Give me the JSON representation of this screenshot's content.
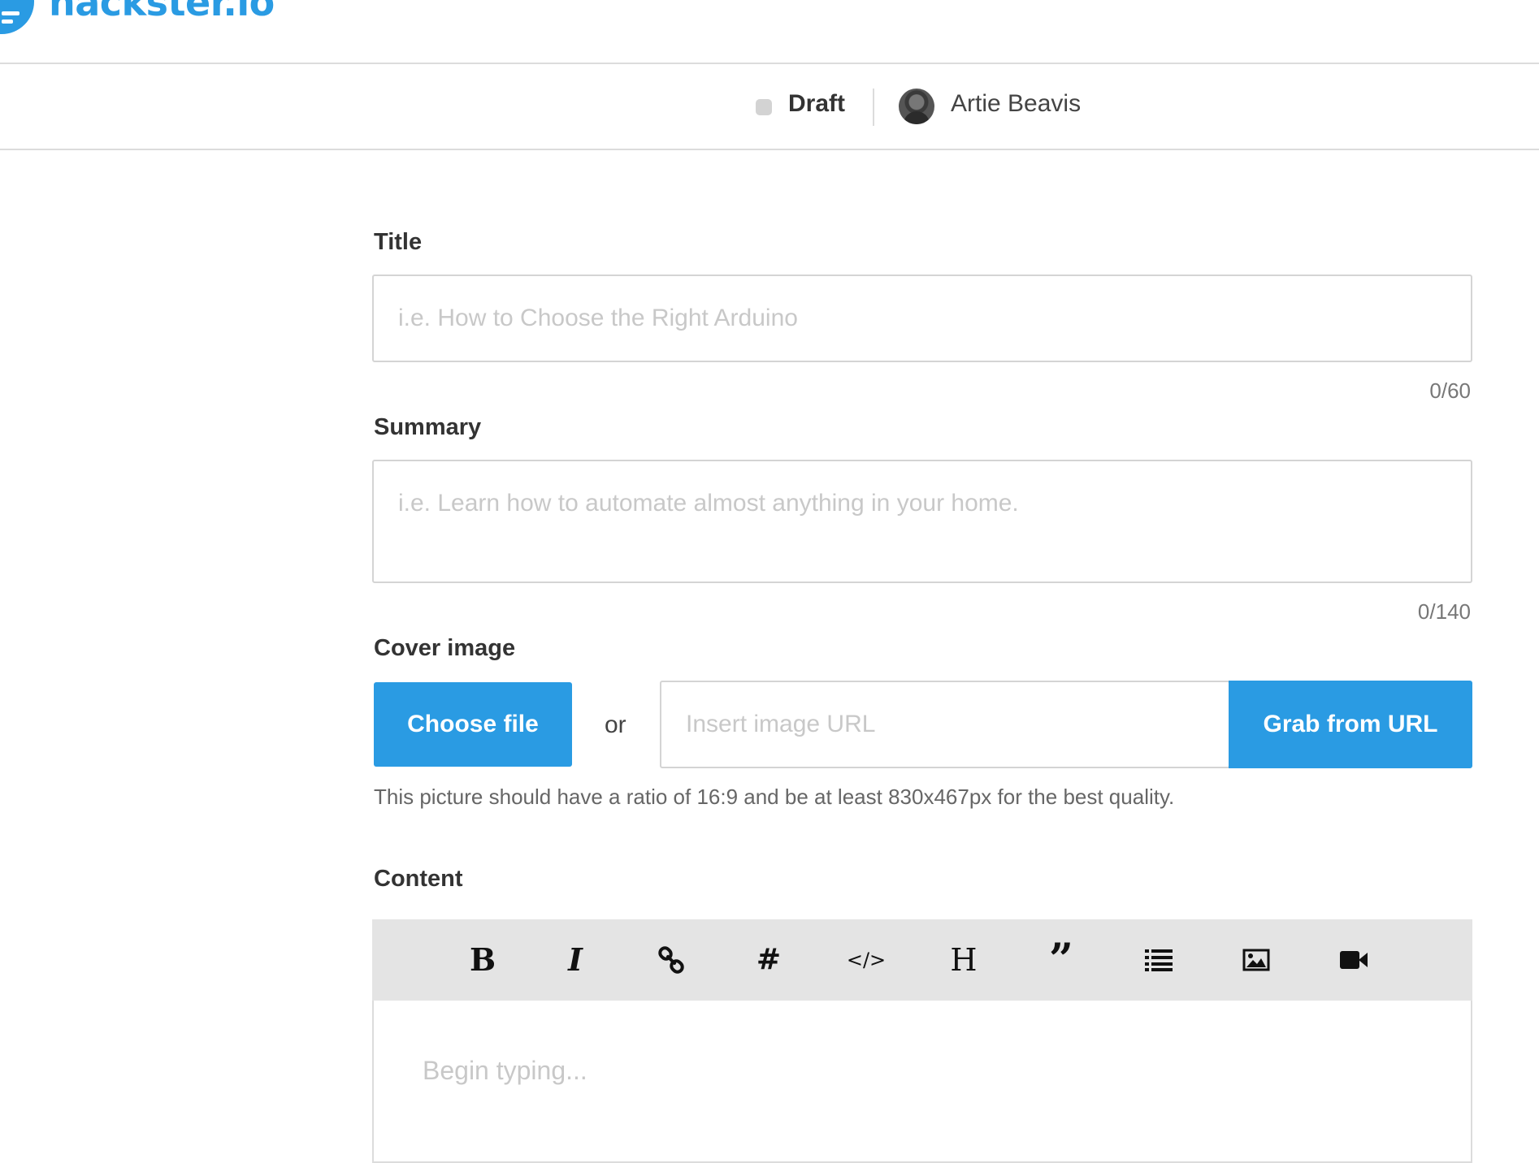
{
  "header": {
    "logo_text": "hackster.io"
  },
  "subheader": {
    "status": "Draft",
    "user_name": "Artie Beavis"
  },
  "form": {
    "title": {
      "label": "Title",
      "placeholder": "i.e. How to Choose the Right Arduino",
      "value": "",
      "counter": "0/60"
    },
    "summary": {
      "label": "Summary",
      "placeholder": "i.e. Learn how to automate almost anything in your home.",
      "value": "",
      "counter": "0/140"
    },
    "cover": {
      "label": "Cover image",
      "choose_file_label": "Choose file",
      "or_text": "or",
      "url_placeholder": "Insert image URL",
      "url_value": "",
      "grab_label": "Grab from URL",
      "hint": "This picture should have a ratio of 16:9 and be at least 830x467px for the best quality."
    },
    "content": {
      "label": "Content",
      "placeholder": "Begin typing...",
      "toolbar": [
        {
          "name": "bold",
          "icon": "bold-icon"
        },
        {
          "name": "italic",
          "icon": "italic-icon"
        },
        {
          "name": "link",
          "icon": "link-icon"
        },
        {
          "name": "hashtag",
          "icon": "hashtag-icon"
        },
        {
          "name": "code",
          "icon": "code-icon"
        },
        {
          "name": "heading",
          "icon": "heading-icon"
        },
        {
          "name": "quote",
          "icon": "quote-icon"
        },
        {
          "name": "list",
          "icon": "list-icon"
        },
        {
          "name": "image",
          "icon": "image-icon"
        },
        {
          "name": "video",
          "icon": "video-icon"
        }
      ]
    }
  },
  "colors": {
    "brand": "#2a9be3",
    "border": "#d4d4d4",
    "toolbar_bg": "#e4e4e4",
    "placeholder": "#c8c8c8"
  }
}
